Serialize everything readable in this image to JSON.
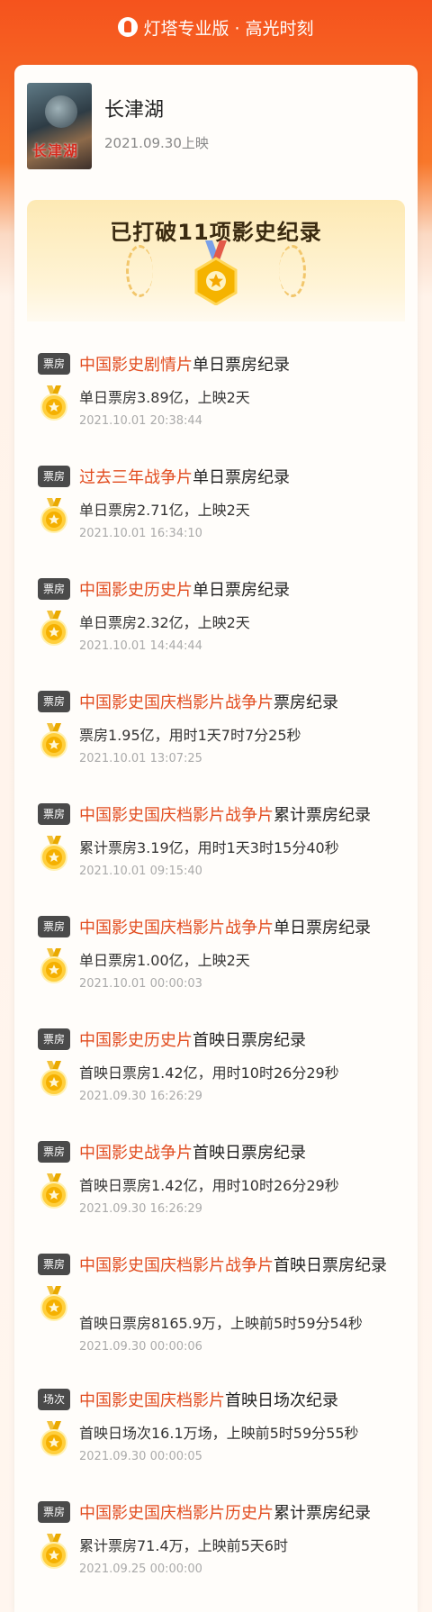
{
  "app": {
    "title": "灯塔专业版 · 高光时刻"
  },
  "movie": {
    "title": "长津湖",
    "release": "2021.09.30上映",
    "poster_text": "长津湖"
  },
  "banner": {
    "text": "已打破11项影史纪录"
  },
  "records": [
    {
      "tag": "票房",
      "highlight": "中国影史剧情片",
      "suffix": "单日票房纪录",
      "detail": "单日票房3.89亿，上映2天",
      "time": "2021.10.01 20:38:44"
    },
    {
      "tag": "票房",
      "highlight": "过去三年战争片",
      "suffix": "单日票房纪录",
      "detail": "单日票房2.71亿，上映2天",
      "time": "2021.10.01 16:34:10"
    },
    {
      "tag": "票房",
      "highlight": "中国影史历史片",
      "suffix": "单日票房纪录",
      "detail": "单日票房2.32亿，上映2天",
      "time": "2021.10.01 14:44:44"
    },
    {
      "tag": "票房",
      "highlight": "中国影史国庆档影片战争片",
      "suffix": "票房纪录",
      "detail": "票房1.95亿，用时1天7时7分25秒",
      "time": "2021.10.01 13:07:25"
    },
    {
      "tag": "票房",
      "highlight": "中国影史国庆档影片战争片",
      "suffix": "累计票房纪录",
      "detail": "累计票房3.19亿，用时1天3时15分40秒",
      "time": "2021.10.01 09:15:40"
    },
    {
      "tag": "票房",
      "highlight": "中国影史国庆档影片战争片",
      "suffix": "单日票房纪录",
      "detail": "单日票房1.00亿，上映2天",
      "time": "2021.10.01 00:00:03"
    },
    {
      "tag": "票房",
      "highlight": "中国影史历史片",
      "suffix": "首映日票房纪录",
      "detail": "首映日票房1.42亿，用时10时26分29秒",
      "time": "2021.09.30 16:26:29"
    },
    {
      "tag": "票房",
      "highlight": "中国影史战争片",
      "suffix": "首映日票房纪录",
      "detail": "首映日票房1.42亿，用时10时26分29秒",
      "time": "2021.09.30 16:26:29"
    },
    {
      "tag": "票房",
      "highlight": "中国影史国庆档影片战争片",
      "suffix": "首映日票房纪录",
      "detail": "首映日票房8165.9万，上映前5时59分54秒",
      "time": "2021.09.30 00:00:06"
    },
    {
      "tag": "场次",
      "highlight": "中国影史国庆档影片",
      "suffix": "首映日场次纪录",
      "detail": "首映日场次16.1万场，上映前5时59分55秒",
      "time": "2021.09.30 00:00:05"
    },
    {
      "tag": "票房",
      "highlight": "中国影史国庆档影片历史片",
      "suffix": "累计票房纪录",
      "detail": "累计票房71.4万，上映前5天6时",
      "time": "2021.09.25 00:00:00"
    }
  ],
  "colors": {
    "accent": "#e24c1f",
    "header": "#f5531d",
    "tag_bg": "#4a4a4a",
    "medal": "#f5b800"
  }
}
